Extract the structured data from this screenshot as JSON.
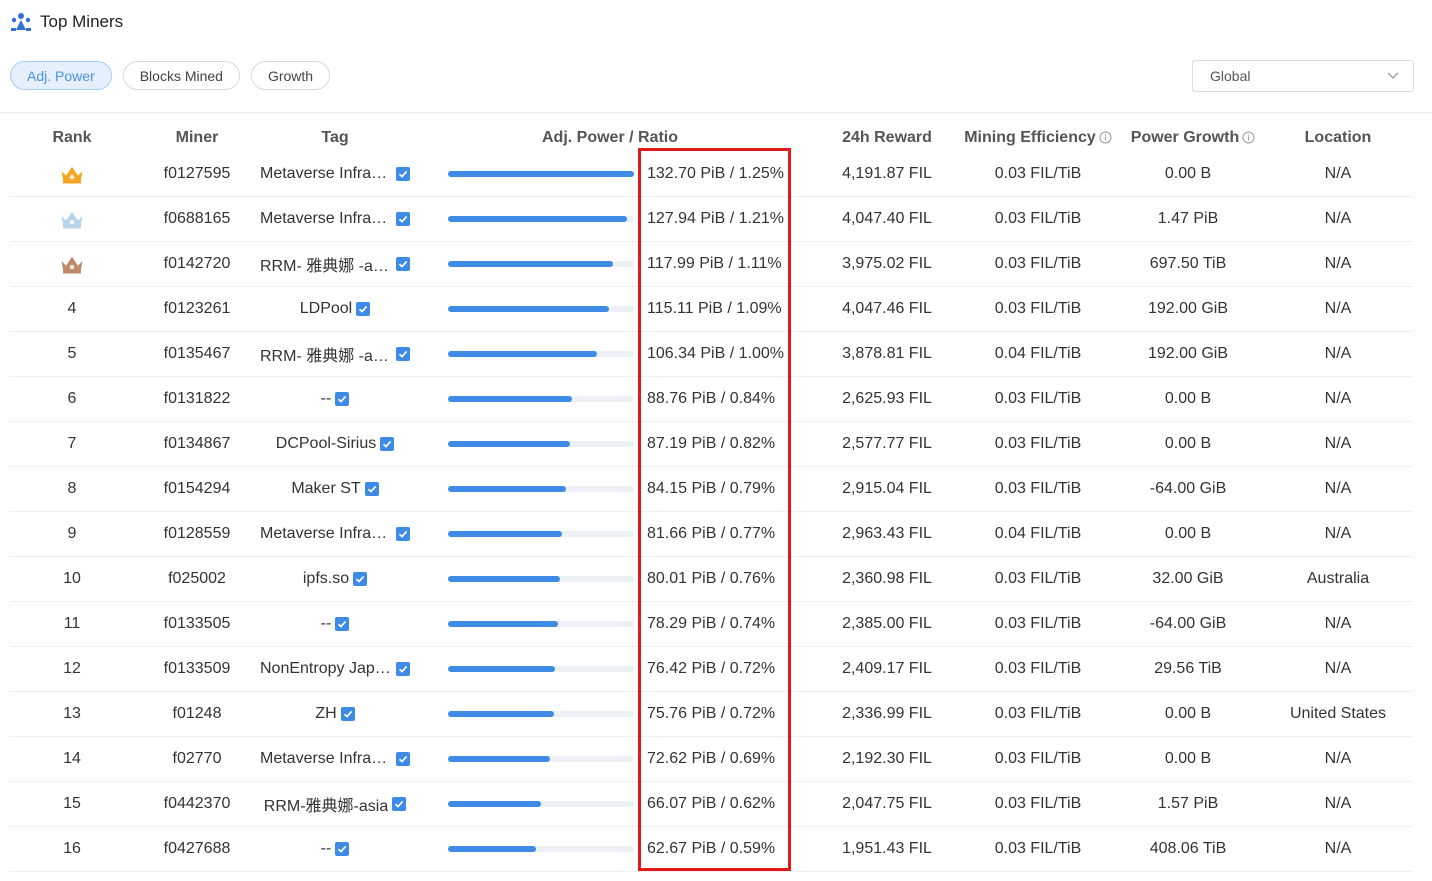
{
  "header": {
    "title": "Top Miners",
    "logo_icon": "miners-logo-icon"
  },
  "filters": [
    {
      "label": "Adj. Power",
      "active": true
    },
    {
      "label": "Blocks Mined",
      "active": false
    },
    {
      "label": "Growth",
      "active": false
    }
  ],
  "region_select": {
    "value": "Global"
  },
  "columns": {
    "rank": "Rank",
    "miner": "Miner",
    "tag": "Tag",
    "power": "Adj. Power / Ratio",
    "reward": "24h Reward",
    "efficiency": "Mining Efficiency",
    "growth": "Power Growth",
    "location": "Location"
  },
  "colors": {
    "accent": "#3d8be6",
    "highlight": "#e0191f",
    "crown_gold": "#f5a623",
    "crown_silver": "#b9d4ea",
    "crown_bronze": "#c08a6a"
  },
  "rows": [
    {
      "rank": "",
      "crown": "gold",
      "miner": "f0127595",
      "tag": "Metaverse Infrastructure",
      "power": "132.70 PiB / 1.25%",
      "bar_fraction": 1.0,
      "reward": "4,191.87 FIL",
      "efficiency": "0.03 FIL/TiB",
      "growth": "0.00 B",
      "location": "N/A"
    },
    {
      "rank": "",
      "crown": "silver",
      "miner": "f0688165",
      "tag": "Metaverse Infrastructure",
      "power": "127.94 PiB / 1.21%",
      "bar_fraction": 0.964,
      "reward": "4,047.40 FIL",
      "efficiency": "0.03 FIL/TiB",
      "growth": "1.47 PiB",
      "location": "N/A"
    },
    {
      "rank": "",
      "crown": "bronze",
      "miner": "f0142720",
      "tag": "RRM- 雅典娜 -asia",
      "power": "117.99 PiB / 1.11%",
      "bar_fraction": 0.889,
      "reward": "3,975.02 FIL",
      "efficiency": "0.03 FIL/TiB",
      "growth": "697.50 TiB",
      "location": "N/A"
    },
    {
      "rank": "4",
      "crown": "",
      "miner": "f0123261",
      "tag": "LDPool",
      "power": "115.11 PiB / 1.09%",
      "bar_fraction": 0.867,
      "reward": "4,047.46 FIL",
      "efficiency": "0.03 FIL/TiB",
      "growth": "192.00 GiB",
      "location": "N/A"
    },
    {
      "rank": "5",
      "crown": "",
      "miner": "f0135467",
      "tag": "RRM- 雅典娜 -asia",
      "power": "106.34 PiB / 1.00%",
      "bar_fraction": 0.801,
      "reward": "3,878.81 FIL",
      "efficiency": "0.04 FIL/TiB",
      "growth": "192.00 GiB",
      "location": "N/A"
    },
    {
      "rank": "6",
      "crown": "",
      "miner": "f0131822",
      "tag": "--",
      "power": "88.76 PiB / 0.84%",
      "bar_fraction": 0.669,
      "reward": "2,625.93 FIL",
      "efficiency": "0.03 FIL/TiB",
      "growth": "0.00 B",
      "location": "N/A"
    },
    {
      "rank": "7",
      "crown": "",
      "miner": "f0134867",
      "tag": "DCPool-Sirius",
      "power": "87.19 PiB / 0.82%",
      "bar_fraction": 0.657,
      "reward": "2,577.77 FIL",
      "efficiency": "0.03 FIL/TiB",
      "growth": "0.00 B",
      "location": "N/A"
    },
    {
      "rank": "8",
      "crown": "",
      "miner": "f0154294",
      "tag": "Maker ST",
      "power": "84.15 PiB / 0.79%",
      "bar_fraction": 0.634,
      "reward": "2,915.04 FIL",
      "efficiency": "0.03 FIL/TiB",
      "growth": "-64.00 GiB",
      "location": "N/A"
    },
    {
      "rank": "9",
      "crown": "",
      "miner": "f0128559",
      "tag": "Metaverse Infrastructure",
      "power": "81.66 PiB / 0.77%",
      "bar_fraction": 0.615,
      "reward": "2,963.43 FIL",
      "efficiency": "0.04 FIL/TiB",
      "growth": "0.00 B",
      "location": "N/A"
    },
    {
      "rank": "10",
      "crown": "",
      "miner": "f025002",
      "tag": "ipfs.so",
      "power": "80.01 PiB / 0.76%",
      "bar_fraction": 0.603,
      "reward": "2,360.98 FIL",
      "efficiency": "0.03 FIL/TiB",
      "growth": "32.00 GiB",
      "location": "Australia"
    },
    {
      "rank": "11",
      "crown": "",
      "miner": "f0133505",
      "tag": "--",
      "power": "78.29 PiB / 0.74%",
      "bar_fraction": 0.59,
      "reward": "2,385.00 FIL",
      "efficiency": "0.03 FIL/TiB",
      "growth": "-64.00 GiB",
      "location": "N/A"
    },
    {
      "rank": "12",
      "crown": "",
      "miner": "f0133509",
      "tag": "NonEntropy Japan",
      "power": "76.42 PiB / 0.72%",
      "bar_fraction": 0.576,
      "reward": "2,409.17 FIL",
      "efficiency": "0.03 FIL/TiB",
      "growth": "29.56 TiB",
      "location": "N/A"
    },
    {
      "rank": "13",
      "crown": "",
      "miner": "f01248",
      "tag": "ZH",
      "power": "75.76 PiB / 0.72%",
      "bar_fraction": 0.571,
      "reward": "2,336.99 FIL",
      "efficiency": "0.03 FIL/TiB",
      "growth": "0.00 B",
      "location": "United States"
    },
    {
      "rank": "14",
      "crown": "",
      "miner": "f02770",
      "tag": "Metaverse Infrastructure",
      "power": "72.62 PiB / 0.69%",
      "bar_fraction": 0.547,
      "reward": "2,192.30 FIL",
      "efficiency": "0.03 FIL/TiB",
      "growth": "0.00 B",
      "location": "N/A"
    },
    {
      "rank": "15",
      "crown": "",
      "miner": "f0442370",
      "tag": "RRM-雅典娜-asia",
      "power": "66.07 PiB / 0.62%",
      "bar_fraction": 0.498,
      "reward": "2,047.75 FIL",
      "efficiency": "0.03 FIL/TiB",
      "growth": "1.57 PiB",
      "location": "N/A"
    },
    {
      "rank": "16",
      "crown": "",
      "miner": "f0427688",
      "tag": "--",
      "power": "62.67 PiB / 0.59%",
      "bar_fraction": 0.472,
      "reward": "1,951.43 FIL",
      "efficiency": "0.03 FIL/TiB",
      "growth": "408.06 TiB",
      "location": "N/A"
    }
  ]
}
